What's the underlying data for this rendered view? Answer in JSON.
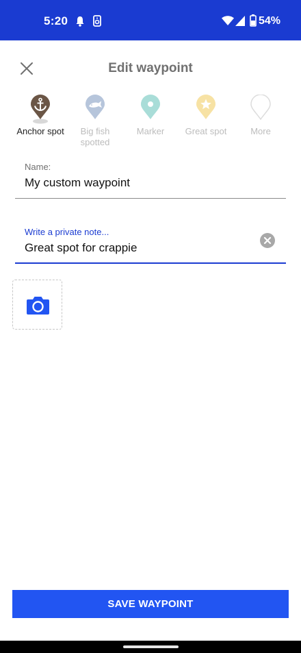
{
  "status_bar": {
    "time": "5:20",
    "battery": "54%",
    "icons": [
      "notification-bell-icon",
      "cast-icon",
      "wifi-icon",
      "signal-icon",
      "battery-icon"
    ]
  },
  "header": {
    "title": "Edit waypoint",
    "close_icon": "close-icon"
  },
  "waypoint_icons": [
    {
      "label": "Anchor spot",
      "icon": "anchor-pin-icon",
      "color": "#6b5646",
      "selected": true
    },
    {
      "label": "Big fish spotted",
      "icon": "fish-pin-icon",
      "color": "#b6c5db",
      "selected": false
    },
    {
      "label": "Marker",
      "icon": "marker-pin-icon",
      "color": "#a9ddd8",
      "selected": false
    },
    {
      "label": "Great spot",
      "icon": "star-pin-icon",
      "color": "#f7e2a4",
      "selected": false
    },
    {
      "label": "More",
      "icon": "outline-pin-icon",
      "color": "#dcdcdc",
      "selected": false
    }
  ],
  "name_field": {
    "label": "Name:",
    "value": "My custom waypoint"
  },
  "note_field": {
    "label": "Write a private note...",
    "value": "Great spot for crappie",
    "clear_icon": "clear-circle-icon"
  },
  "photo": {
    "icon": "camera-icon"
  },
  "save_button": {
    "label": "SAVE WAYPOINT"
  },
  "colors": {
    "status_bar": "#1a3bd1",
    "accent": "#2255f2",
    "title_gray": "#707070"
  }
}
